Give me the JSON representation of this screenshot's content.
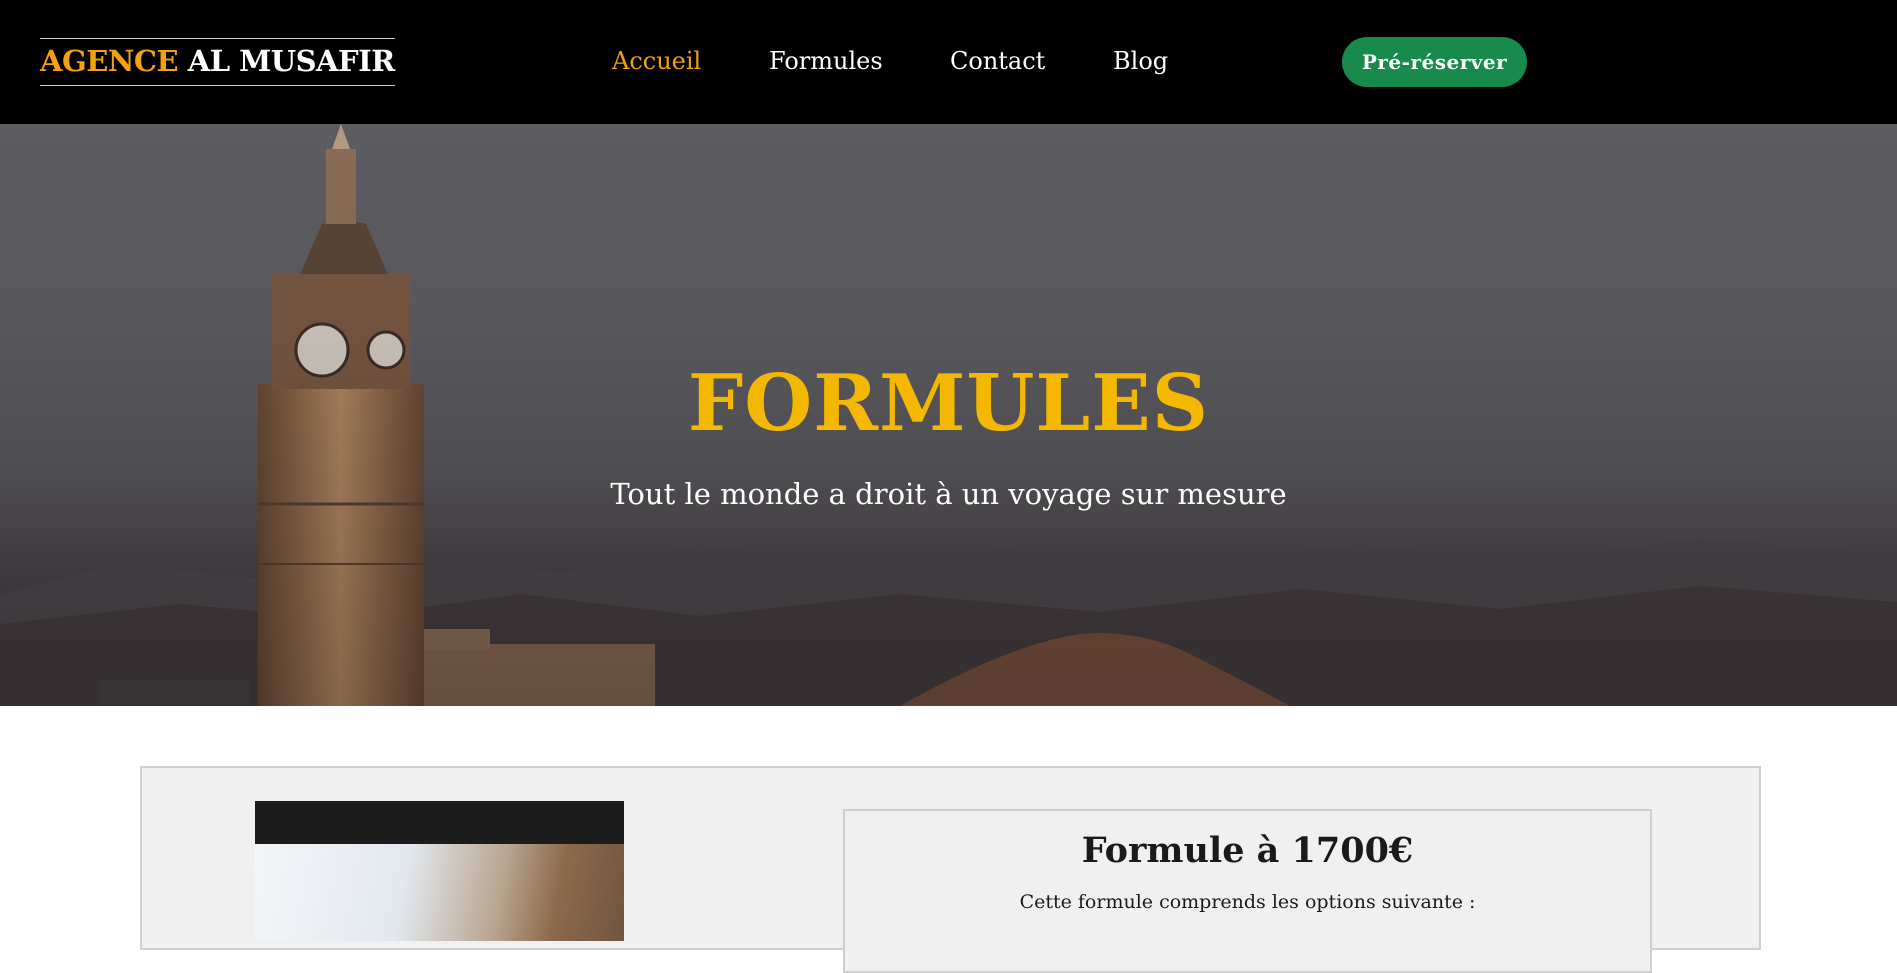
{
  "header": {
    "logo_part1": "AGENCE",
    "logo_part2": "AL MUSAFIR",
    "nav": [
      {
        "label": "Accueil",
        "active": true
      },
      {
        "label": "Formules",
        "active": false
      },
      {
        "label": "Contact",
        "active": false
      },
      {
        "label": "Blog",
        "active": false
      }
    ],
    "cta_label": "Pré-réserver"
  },
  "hero": {
    "title": "FORMULES",
    "subtitle": "Tout le monde a droit à un voyage sur mesure"
  },
  "offer": {
    "title": "Formule à 1700€",
    "description": "Cette formule comprends les options suivante :"
  },
  "colors": {
    "accent": "#f5a00e",
    "hero_title": "#f5b800",
    "cta": "#178a4c",
    "navbar": "#000000"
  }
}
